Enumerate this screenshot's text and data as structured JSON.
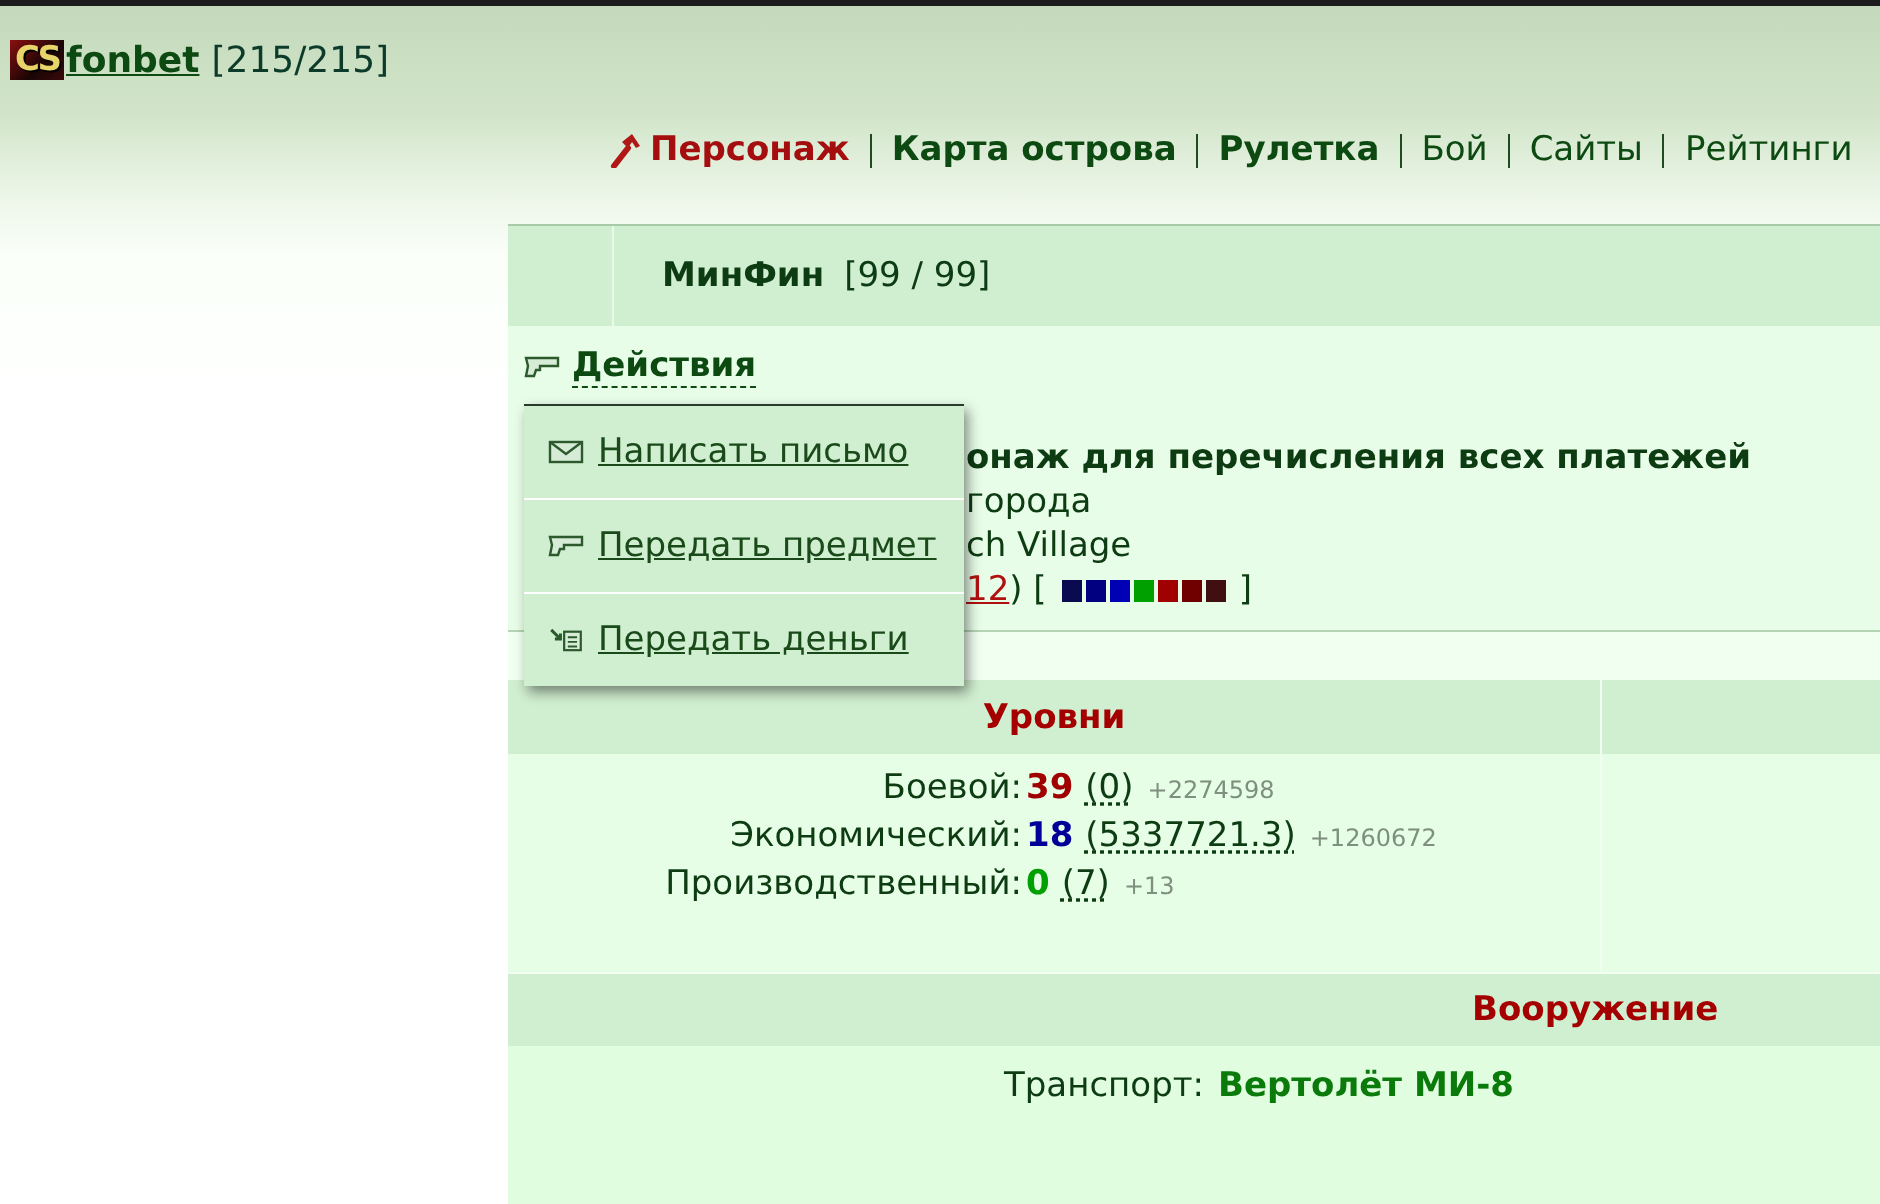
{
  "site": {
    "logo_text": "CS",
    "name": "fonbet",
    "counter": "[215/215]"
  },
  "nav": [
    {
      "label": "Персонаж",
      "selected": true,
      "bold": true
    },
    {
      "label": "Карта острова",
      "selected": false,
      "bold": true
    },
    {
      "label": "Рулетка",
      "selected": false,
      "bold": true
    },
    {
      "label": "Бой",
      "selected": false,
      "bold": false
    },
    {
      "label": "Сайты",
      "selected": false,
      "bold": false
    },
    {
      "label": "Рейтинги",
      "selected": false,
      "bold": false
    }
  ],
  "profile": {
    "name": "МинФин",
    "counter": "[99 / 99]"
  },
  "actions": {
    "label": "Действия",
    "expanded": true,
    "items": [
      {
        "kind": "mail",
        "label": "Написать письмо"
      },
      {
        "kind": "item",
        "label": "Передать предмет"
      },
      {
        "kind": "money",
        "label": "Передать деньги"
      }
    ]
  },
  "info": {
    "title": "онаж для перечисления всех платежей",
    "line_2": "города",
    "line_3": "ch Village",
    "link": "12",
    "link_suffix": ") [",
    "status_squares": [
      {
        "color": "#0a0a50"
      },
      {
        "color": "#000080"
      },
      {
        "color": "#0000b4"
      },
      {
        "color": "#00a000"
      },
      {
        "color": "#a00000"
      },
      {
        "color": "#700000"
      },
      {
        "color": "#401010"
      }
    ],
    "bracket_close": "]"
  },
  "levels": {
    "title": "Уровни",
    "rows": [
      {
        "label": "Боевой:",
        "value": "39",
        "color": "#a00000",
        "points": "(0)",
        "gain": "+2274598"
      },
      {
        "label": "Экономический:",
        "value": "18",
        "color": "#000099",
        "points": "(5337721.3)",
        "gain": "+1260672"
      },
      {
        "label": "Производственный:",
        "value": "0",
        "color": "#00a000",
        "points": "(7)",
        "gain": "+13"
      }
    ]
  },
  "equipment": {
    "title": "Вооружение",
    "rows": [
      {
        "label": "Транспорт:",
        "value": "Вертолёт МИ-8"
      }
    ]
  }
}
